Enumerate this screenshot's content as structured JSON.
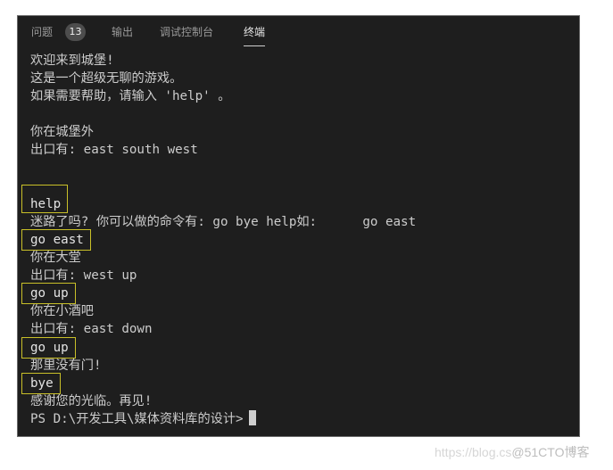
{
  "panel_tabs": {
    "problems": {
      "label": "问题",
      "count": "13"
    },
    "output": {
      "label": "输出"
    },
    "debug_console": {
      "label": "调试控制台"
    },
    "terminal": {
      "label": "终端",
      "active": true
    }
  },
  "terminal": {
    "lines": [
      {
        "text": "欢迎来到城堡!",
        "type": "output"
      },
      {
        "text": "这是一个超级无聊的游戏。",
        "type": "output"
      },
      {
        "text": "如果需要帮助，请输入 'help' 。",
        "type": "output"
      },
      {
        "text": "",
        "type": "blank"
      },
      {
        "text": "你在城堡外",
        "type": "output"
      },
      {
        "text": "出口有: east south west",
        "type": "output"
      },
      {
        "text": "",
        "type": "blank"
      },
      {
        "text": "",
        "type": "blank"
      },
      {
        "text": "help",
        "type": "input",
        "highlighted": true
      },
      {
        "text": "迷路了吗? 你可以做的命令有: go bye help如:      go east",
        "type": "output"
      },
      {
        "text": "go east",
        "type": "input",
        "highlighted": true
      },
      {
        "text": "你在大堂",
        "type": "output"
      },
      {
        "text": "出口有: west up",
        "type": "output"
      },
      {
        "text": "go up",
        "type": "input",
        "highlighted": true
      },
      {
        "text": "你在小酒吧",
        "type": "output"
      },
      {
        "text": "出口有: east down",
        "type": "output"
      },
      {
        "text": "go up",
        "type": "input",
        "highlighted": true
      },
      {
        "text": "那里没有门!",
        "type": "output"
      },
      {
        "text": "bye",
        "type": "input",
        "highlighted": true
      },
      {
        "text": "感谢您的光临。再见!",
        "type": "output"
      },
      {
        "text": "PS D:\\开发工具\\媒体资料库的设计>",
        "type": "prompt"
      }
    ],
    "highlight_color": "#c9c028",
    "background": "#1e1e1e",
    "foreground": "#cccccc"
  },
  "watermark": {
    "url_text": "https://blog.cs",
    "brand_text": "@51CTO博客"
  }
}
